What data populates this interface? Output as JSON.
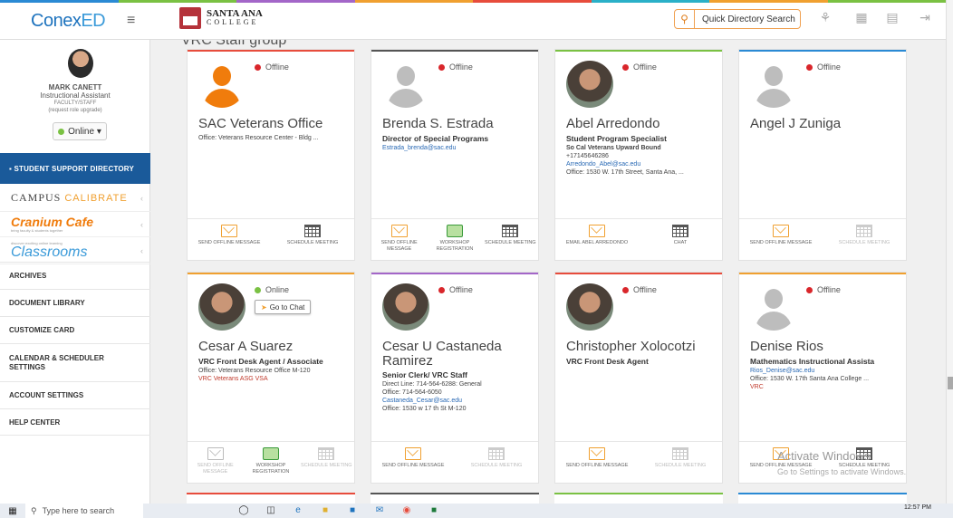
{
  "header": {
    "brand_a": "Conex",
    "brand_b": "ED",
    "menu_icon": "hamburger-icon",
    "college_l1": "SANTA ANA",
    "college_l2": "COLLEGE",
    "search_placeholder": "Quick Directory Search",
    "stripe_colors": [
      "#2a8ad4",
      "#7ac143",
      "#a366c8",
      "#f0a030",
      "#e74c3c",
      "#2ab0c8",
      "#f0a030",
      "#7ac143"
    ]
  },
  "user": {
    "name": "MARK CANETT",
    "title": "Instructional Assistant",
    "role": "FACULTY/STAFF",
    "upgrade": "(request role upgrade)",
    "status": "Online ▾"
  },
  "sidebar": {
    "active": "▪  STUDENT SUPPORT DIRECTORY",
    "calibrate_a": "CAMPUS",
    "calibrate_b": "CALIBRATE",
    "cranium": "Cranium Cafe",
    "cranium_sub": "bring faculty & students together",
    "classrooms": "Classrooms",
    "classrooms_sub": "discover exciting online learning",
    "items": [
      "ARCHIVES",
      "DOCUMENT LIBRARY",
      "CUSTOMIZE CARD",
      "CALENDAR & SCHEDULER SETTINGS",
      "ACCOUNT SETTINGS",
      "HELP CENTER"
    ]
  },
  "main": {
    "group_title": "VRC Staff group",
    "cards": [
      {
        "status": "Offline",
        "name": "SAC Veterans Office",
        "role": "",
        "sub": "",
        "lines": [
          "Office: Veterans Resource Center - Bldg ..."
        ],
        "a1": "SEND OFFLINE MESSAGE",
        "a2": "",
        "a3": "SCHEDULE MEETING"
      },
      {
        "status": "Offline",
        "name": "Brenda S. Estrada",
        "role": "Director of Special Programs",
        "sub": "",
        "lines": [
          "Estrada_brenda@sac.edu"
        ],
        "a1": "SEND OFFLINE MESSAGE",
        "a2": "WORKSHOP REGISTRATION",
        "a3": "SCHEDULE MEETING"
      },
      {
        "status": "Offline",
        "name": "Abel Arredondo",
        "role": "Student Program Specialist",
        "sub": "So Cal Veterans Upward Bound",
        "lines": [
          "+17145646286",
          "Arredondo_Abel@sac.edu",
          "Office: 1530 W. 17th Street, Santa Ana, ..."
        ],
        "a1": "EMAIL ABEL ARREDONDO",
        "a2": "",
        "a3": "CHAT"
      },
      {
        "status": "Offline",
        "name": "Angel J Zuniga",
        "role": "",
        "sub": "",
        "lines": [],
        "a1": "SEND OFFLINE MESSAGE",
        "a2": "",
        "a3": "SCHEDULE MEETING"
      },
      {
        "status": "Online",
        "chat": "Go to Chat",
        "name": "Cesar A Suarez",
        "role": "VRC Front Desk Agent / Associate",
        "sub": "",
        "lines": [
          "Office: Veterans Resource Office M-120",
          "VRC Veterans ASG VSA"
        ],
        "a1": "SEND OFFLINE MESSAGE",
        "a2": "WORKSHOP REGISTRATION",
        "a3": "SCHEDULE MEETING"
      },
      {
        "status": "Offline",
        "name": "Cesar U Castaneda",
        "name2": "Ramirez",
        "role": "Senior Clerk/ VRC Staff",
        "sub": "",
        "lines": [
          "Direct Line: 714-564-6288: General",
          "Office: 714-564-6050",
          "Castaneda_Cesar@sac.edu",
          "Office: 1530 w 17 th St M-120"
        ],
        "a1": "SEND OFFLINE MESSAGE",
        "a2": "",
        "a3": "SCHEDULE MEETING"
      },
      {
        "status": "Offline",
        "name": "Christopher Xolocotzi",
        "role": "VRC Front Desk Agent",
        "sub": "",
        "lines": [],
        "a1": "SEND OFFLINE MESSAGE",
        "a2": "",
        "a3": "SCHEDULE MEETING"
      },
      {
        "status": "Offline",
        "name": "Denise Rios",
        "role": "Mathematics Instructional Assista",
        "sub": "",
        "lines": [
          "Rios_Denise@sac.edu",
          "Office: 1530 W. 17th Santa Ana College ...",
          "VRC"
        ],
        "a1": "SEND OFFLINE MESSAGE",
        "a2": "",
        "a3": "SCHEDULE MEETING"
      }
    ]
  },
  "watermark": {
    "title": "Activate Windows",
    "sub": "Go to Settings to activate Windows."
  },
  "taskbar": {
    "search": "Type here to search",
    "time": "12:57 PM"
  }
}
